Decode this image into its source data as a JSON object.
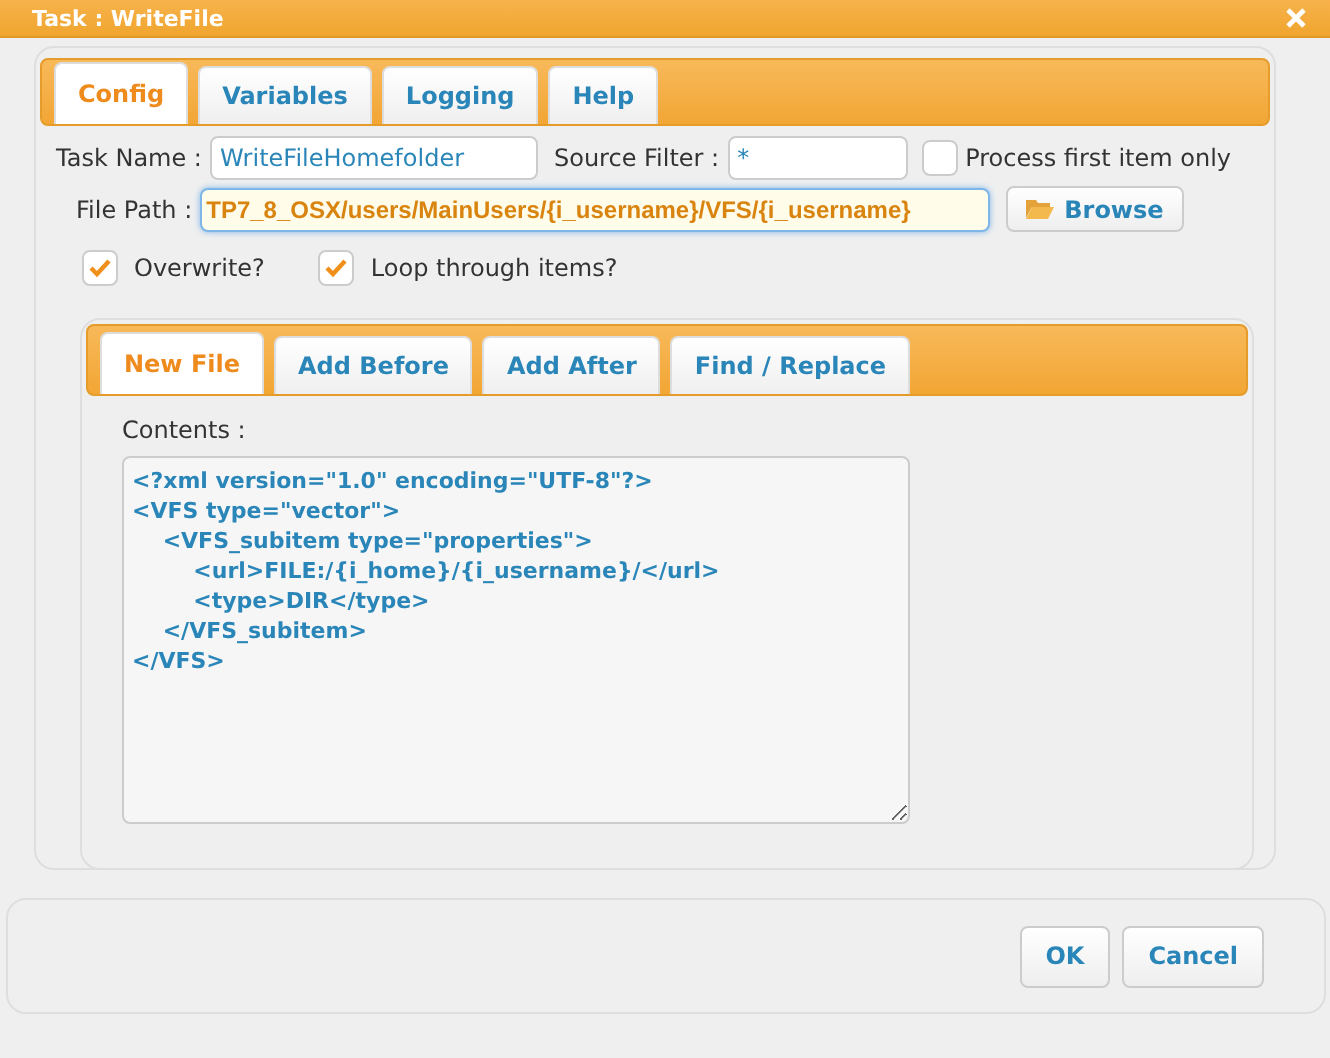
{
  "window": {
    "title": "Task : WriteFile"
  },
  "tabs": [
    {
      "label": "Config",
      "selected": true
    },
    {
      "label": "Variables",
      "selected": false
    },
    {
      "label": "Logging",
      "selected": false
    },
    {
      "label": "Help",
      "selected": false
    }
  ],
  "form": {
    "task_name": {
      "label": "Task Name :",
      "value": "WriteFileHomefolder"
    },
    "source_filter": {
      "label": "Source Filter :",
      "value": "*"
    },
    "process_first": {
      "label": "Process first item only",
      "checked": false
    },
    "file_path": {
      "label": "File Path :",
      "value": "TP7_8_OSX/users/MainUsers/{i_username}/VFS/{i_username}",
      "focused": true
    },
    "browse": "Browse",
    "options": [
      {
        "label": "Overwrite?",
        "checked": true
      },
      {
        "label": "Loop through items?",
        "checked": true
      }
    ]
  },
  "sub_tabs": [
    {
      "label": "New File",
      "selected": true
    },
    {
      "label": "Add Before",
      "selected": false
    },
    {
      "label": "Add After",
      "selected": false
    },
    {
      "label": "Find / Replace",
      "selected": false
    }
  ],
  "contents": {
    "label": "Contents :",
    "value": "<?xml version=\"1.0\" encoding=\"UTF-8\"?>\n<VFS type=\"vector\">\n    <VFS_subitem type=\"properties\">\n        <url>FILE:/{i_home}/{i_username}/</url>\n        <type>DIR</type>\n    </VFS_subitem>\n</VFS>"
  },
  "buttons": [
    "OK",
    "Cancel"
  ]
}
